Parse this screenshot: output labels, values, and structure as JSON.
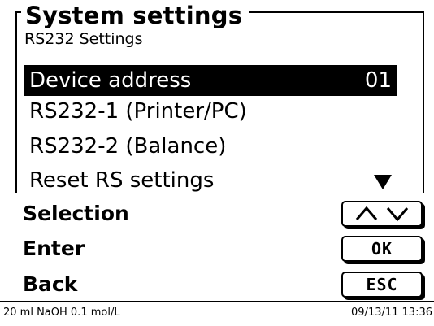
{
  "header": {
    "title": "System settings",
    "subtitle": "RS232 Settings"
  },
  "menu": {
    "items": [
      {
        "label": "Device address",
        "value": "01",
        "selected": true
      },
      {
        "label": "RS232-1 (Printer/PC)"
      },
      {
        "label": "RS232-2 (Balance)"
      },
      {
        "label": "Reset RS settings"
      }
    ],
    "scroll_indicator_icon": "triangle-down-icon"
  },
  "actions": [
    {
      "label": "Selection",
      "key_icon": "up-down-arrows-icon"
    },
    {
      "label": "Enter",
      "key_label": "OK"
    },
    {
      "label": "Back",
      "key_label": "ESC"
    }
  ],
  "status_bar": {
    "left": "20 ml NaOH 0.1 mol/L",
    "right": "09/13/11 13:36"
  }
}
